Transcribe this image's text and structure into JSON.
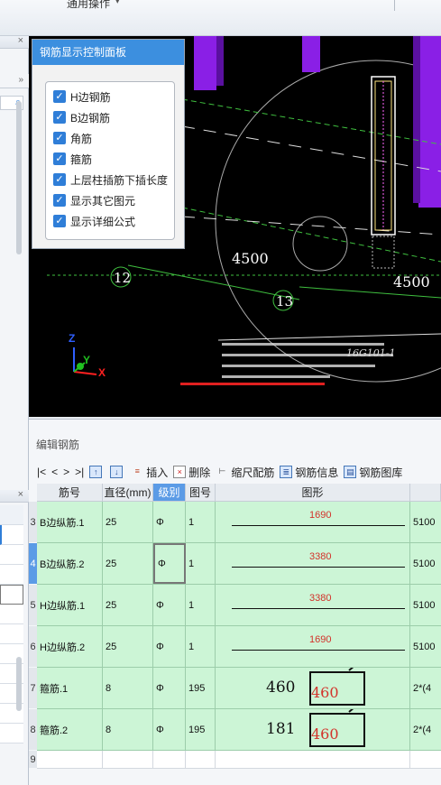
{
  "toolbar_top": {
    "menu_label": "通用操作"
  },
  "control_panel": {
    "title": "钢筋显示控制面板",
    "options": [
      {
        "label": "H边钢筋",
        "checked": true
      },
      {
        "label": "B边钢筋",
        "checked": true
      },
      {
        "label": "角筋",
        "checked": true
      },
      {
        "label": "箍筋",
        "checked": true
      },
      {
        "label": "上层柱插筋下插长度",
        "checked": true
      },
      {
        "label": "显示其它图元",
        "checked": true
      },
      {
        "label": "显示详细公式",
        "checked": true
      }
    ]
  },
  "viewport": {
    "axis_labels": [
      "12",
      "13"
    ],
    "dimensions": [
      "4500",
      "4500"
    ],
    "annotation_code": "16G101-1",
    "coord_axes": {
      "x": "X",
      "y": "Y",
      "z": "Z"
    }
  },
  "editor": {
    "title": "编辑钢筋",
    "toolbar": {
      "nav": [
        "|<",
        "<",
        ">",
        ">|"
      ],
      "insert": "插入",
      "delete": "删除",
      "scale": "缩尺配筋",
      "info": "钢筋信息",
      "library": "钢筋图库"
    },
    "columns": [
      "筋号",
      "直径(mm)",
      "级别",
      "图号",
      "图形"
    ],
    "rows": [
      {
        "num": "3",
        "name": "B边纵筋.1",
        "dia": "25",
        "grade": "Φ",
        "fig": "1",
        "shape_value": "1690",
        "formula": "5100"
      },
      {
        "num": "4",
        "name": "B边纵筋.2",
        "dia": "25",
        "grade": "Φ",
        "fig": "1",
        "shape_value": "3380",
        "formula": "5100"
      },
      {
        "num": "5",
        "name": "H边纵筋.1",
        "dia": "25",
        "grade": "Φ",
        "fig": "1",
        "shape_value": "3380",
        "formula": "5100"
      },
      {
        "num": "6",
        "name": "H边纵筋.2",
        "dia": "25",
        "grade": "Φ",
        "fig": "1",
        "shape_value": "1690",
        "formula": "5100"
      },
      {
        "num": "7",
        "name": "箍筋.1",
        "dia": "8",
        "grade": "Φ",
        "fig": "195",
        "shape_left": "460",
        "shape_box": "460",
        "formula": "2*(4"
      },
      {
        "num": "8",
        "name": "箍筋.2",
        "dia": "8",
        "grade": "Φ",
        "fig": "195",
        "shape_left": "181",
        "shape_box": "460",
        "formula": "2*(4"
      },
      {
        "num": "9",
        "name": "",
        "dia": "",
        "grade": "",
        "fig": "",
        "formula": ""
      }
    ]
  },
  "colors": {
    "accent": "#3c8fdf",
    "row_green": "#ccf5d6",
    "cad_bg": "#000000",
    "column_purple": "#8a1fe6"
  }
}
